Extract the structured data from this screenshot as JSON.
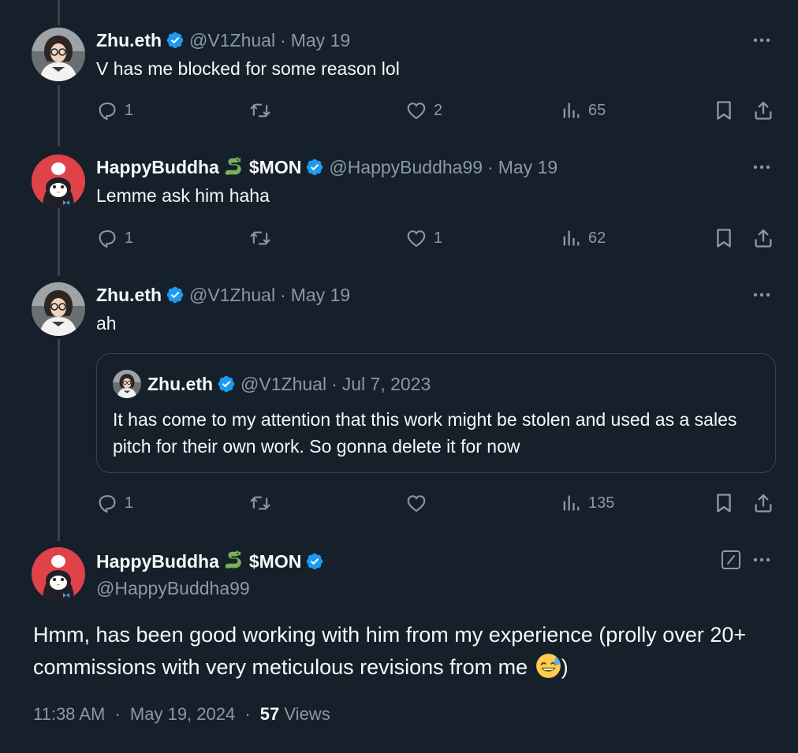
{
  "tweets": [
    {
      "name": "Zhu.eth",
      "handle": "@V1Zhual",
      "date": "May 19",
      "text": "V has me blocked for some reason lol",
      "replies": "1",
      "retweets": "",
      "likes": "2",
      "views": "65"
    },
    {
      "name": "HappyBuddha",
      "name_suffix": "$MON",
      "handle": "@HappyBuddha99",
      "date": "May 19",
      "text": "Lemme ask him haha",
      "replies": "1",
      "retweets": "",
      "likes": "1",
      "views": "62"
    },
    {
      "name": "Zhu.eth",
      "handle": "@V1Zhual",
      "date": "May 19",
      "text": "ah",
      "replies": "1",
      "retweets": "",
      "likes": "",
      "views": "135",
      "quote": {
        "name": "Zhu.eth",
        "handle": "@V1Zhual",
        "date": "Jul 7, 2023",
        "text": "It has come to my attention that this work might be stolen and used as a sales pitch for their own work. So gonna delete it for now"
      }
    }
  ],
  "main": {
    "name": "HappyBuddha",
    "name_suffix": "$MON",
    "handle": "@HappyBuddha99",
    "text": "Hmm, has been good working with him from my experience (prolly over 20+ commissions with very meticulous revisions from me",
    "text_end": ")",
    "time": "11:38 AM",
    "date": "May 19, 2024",
    "views_count": "57",
    "views_label": "Views"
  },
  "icons": {
    "verified": "verified-badge-icon",
    "dragon_emoji": "dragon-emoji-icon",
    "sweat_smile_emoji": "sweat-smile-emoji-icon",
    "reply": "reply-icon",
    "retweet": "retweet-icon",
    "like": "heart-icon",
    "views": "views-chart-icon",
    "bookmark": "bookmark-icon",
    "share": "share-icon",
    "more": "more-dots-icon",
    "edit": "edit-icon"
  },
  "colors": {
    "background": "#15202b",
    "text": "#f7f9f9",
    "muted": "#8b98a5",
    "border": "#38444d",
    "verified": "#1d9bf0"
  }
}
